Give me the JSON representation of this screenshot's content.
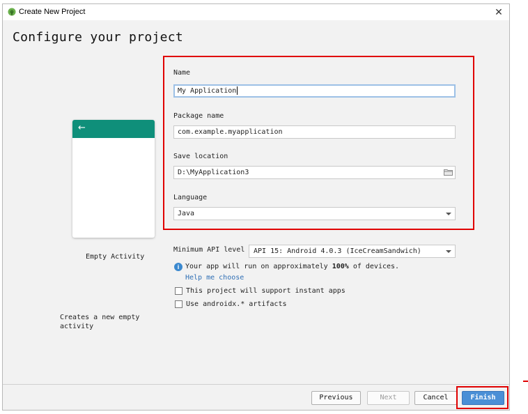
{
  "window": {
    "title": "Create New Project",
    "close_glyph": "✕",
    "icon": "android-studio-icon"
  },
  "page": {
    "heading": "Configure your project"
  },
  "template": {
    "name": "Empty Activity",
    "description": "Creates a new empty activity",
    "back_glyph": "←",
    "appbar_color": "#0f8f7a"
  },
  "form": {
    "name": {
      "label": "Name",
      "value": "My Application"
    },
    "package": {
      "label": "Package name",
      "value": "com.example.myapplication"
    },
    "save_location": {
      "label": "Save location",
      "value": "D:\\MyApplication3",
      "icon": "folder-icon"
    },
    "language": {
      "label": "Language",
      "value": "Java"
    },
    "min_api": {
      "label": "Minimum API level",
      "value": "API 15: Android 4.0.3 (IceCreamSandwich)"
    }
  },
  "info": {
    "icon": "info-icon",
    "text_before": "Your app will run on approximately ",
    "percent": "100%",
    "text_after": " of devices.",
    "help_link": "Help me choose"
  },
  "checkboxes": {
    "instant_apps": {
      "label": "This project will support instant apps",
      "checked": false
    },
    "androidx": {
      "label": "Use androidx.* artifacts",
      "checked": false
    }
  },
  "buttons": {
    "previous": "Previous",
    "next": "Next",
    "cancel": "Cancel",
    "finish": "Finish"
  },
  "colors": {
    "highlight": "#e00000",
    "primary_button": "#4a8fd6",
    "link": "#2f6fb5"
  }
}
